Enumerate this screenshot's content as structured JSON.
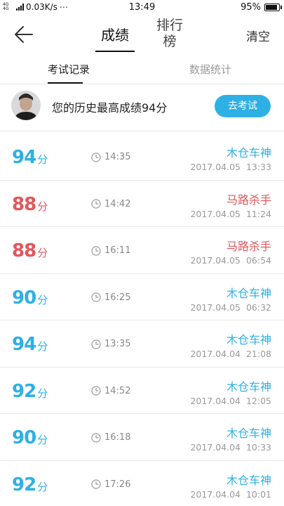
{
  "status_bar": {
    "network": "4G 4G",
    "speed": "0.03K/s",
    "dots": "⋯",
    "time": "13:49",
    "battery": "95%",
    "battery_level": 0.95
  },
  "nav": {
    "back_icon": "back-arrow-icon",
    "tab_score": "成绩",
    "tab_rank": "排行榜",
    "clear": "清空"
  },
  "subtabs": {
    "records": "考试记录",
    "stats": "数据统计"
  },
  "best": {
    "text": "您的历史最高成绩94分",
    "button": "去考试"
  },
  "unit": "分",
  "records": [
    {
      "score": "94",
      "color": "blue",
      "duration": "14:35",
      "user": "木仓车神",
      "date": "2017.04.05",
      "time": "13:33"
    },
    {
      "score": "88",
      "color": "red",
      "duration": "14:42",
      "user": "马路杀手",
      "date": "2017.04.05",
      "time": "11:24"
    },
    {
      "score": "88",
      "color": "red",
      "duration": "16:11",
      "user": "马路杀手",
      "date": "2017.04.05",
      "time": "06:54"
    },
    {
      "score": "90",
      "color": "blue",
      "duration": "16:25",
      "user": "木仓车神",
      "date": "2017.04.05",
      "time": "06:32"
    },
    {
      "score": "94",
      "color": "blue",
      "duration": "13:35",
      "user": "木仓车神",
      "date": "2017.04.04",
      "time": "21:08"
    },
    {
      "score": "92",
      "color": "blue",
      "duration": "14:52",
      "user": "木仓车神",
      "date": "2017.04.04",
      "time": "12:05"
    },
    {
      "score": "90",
      "color": "blue",
      "duration": "16:18",
      "user": "木仓车神",
      "date": "2017.04.04",
      "time": "10:33"
    },
    {
      "score": "92",
      "color": "blue",
      "duration": "17:26",
      "user": "木仓车神",
      "date": "2017.04.04",
      "time": "10:01"
    }
  ],
  "colors": {
    "blue": "#2fb0e4",
    "red": "#e2565a"
  }
}
